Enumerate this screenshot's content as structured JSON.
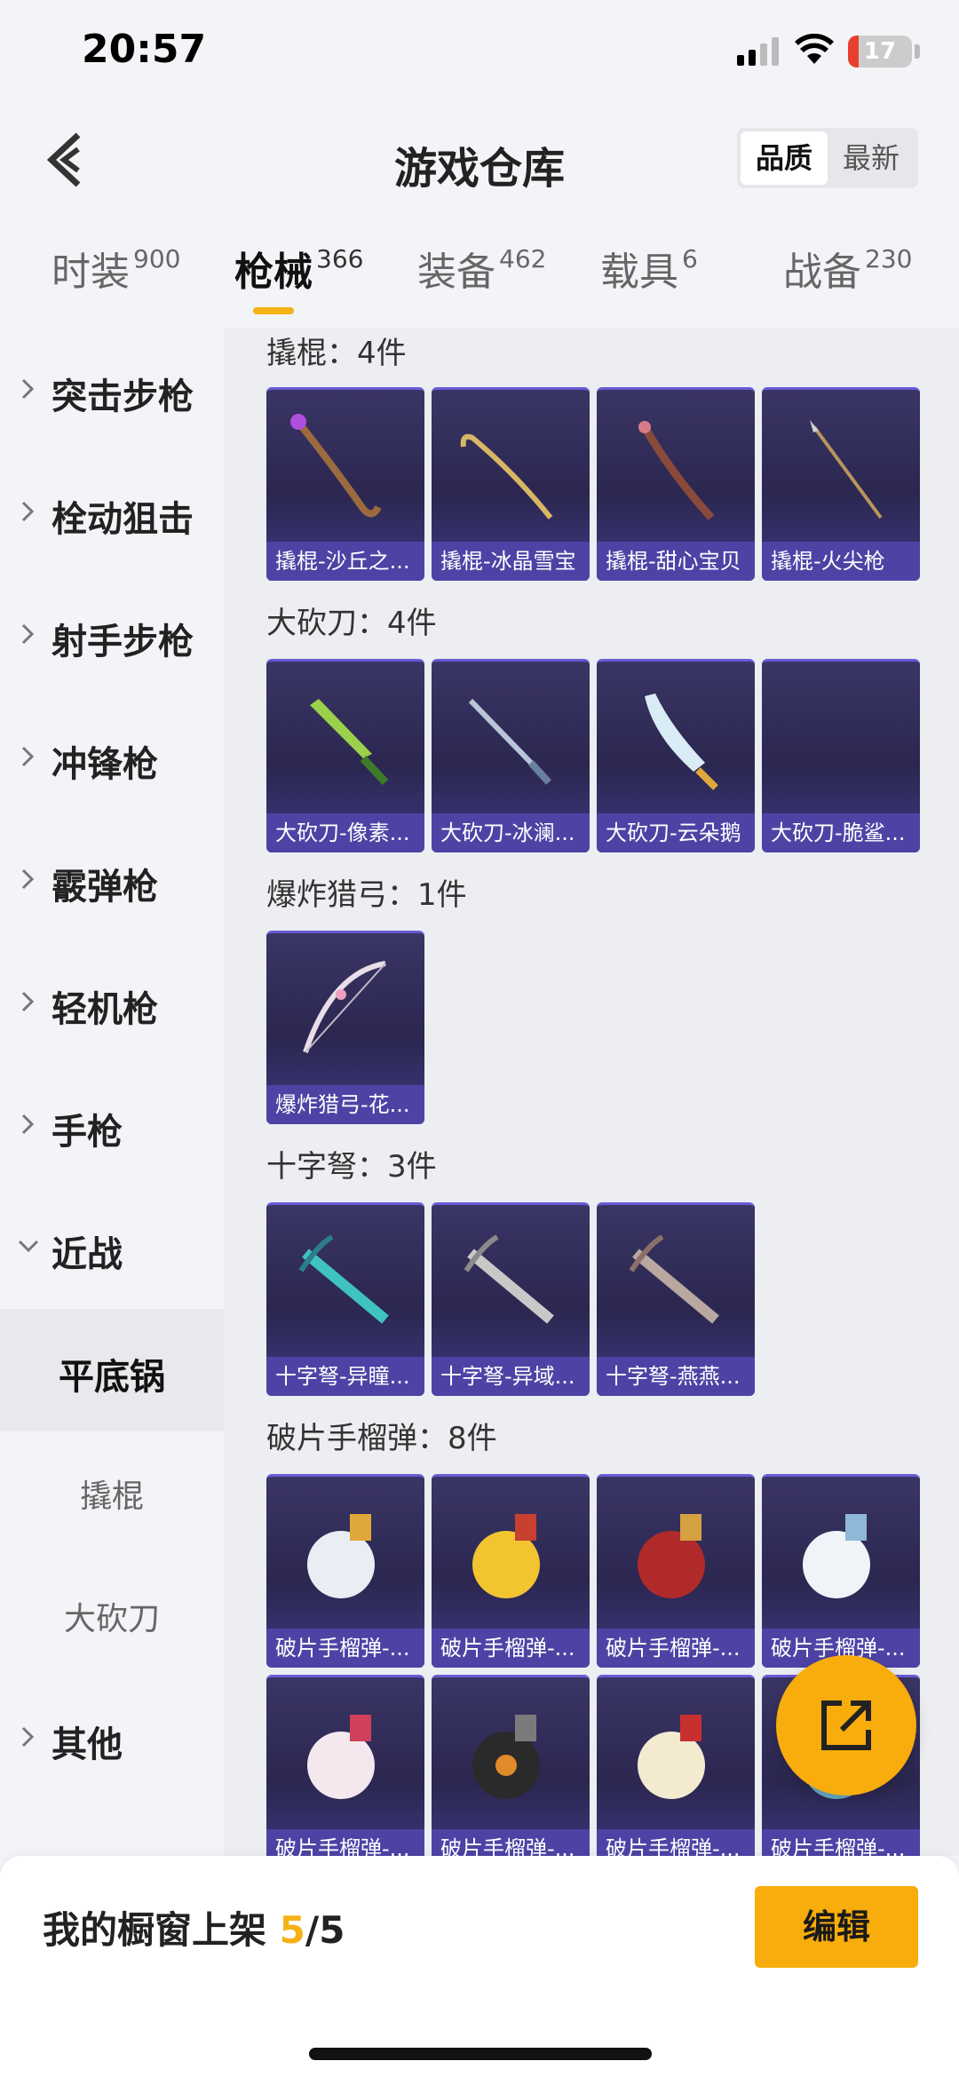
{
  "status": {
    "time": "20:57",
    "battery": "17",
    "battery_level": 0.17
  },
  "header": {
    "title": "游戏仓库",
    "sort": [
      "品质",
      "最新"
    ],
    "sort_active": "品质"
  },
  "tabs": [
    {
      "label": "时装",
      "count": "900"
    },
    {
      "label": "枪械",
      "count": "366",
      "active": true
    },
    {
      "label": "装备",
      "count": "462"
    },
    {
      "label": "载具",
      "count": "6"
    },
    {
      "label": "战备",
      "count": "230"
    }
  ],
  "sidebar": {
    "items": [
      "突击步枪",
      "栓动狙击",
      "射手步枪",
      "冲锋枪",
      "霰弹枪",
      "轻机枪",
      "手枪",
      "近战",
      "平底锅",
      "撬棍",
      "大砍刀",
      "其他"
    ]
  },
  "sections": [
    {
      "title": "撬棍：4件",
      "items": [
        "撬棍-沙丘之...",
        "撬棍-冰晶雪宝",
        "撬棍-甜心宝贝",
        "撬棍-火尖枪"
      ]
    },
    {
      "title": "大砍刀：4件",
      "items": [
        "大砍刀-像素...",
        "大砍刀-冰澜...",
        "大砍刀-云朵鹅",
        "大砍刀-脆鲨..."
      ]
    },
    {
      "title": "爆炸猎弓：1件",
      "items": [
        "爆炸猎弓-花..."
      ]
    },
    {
      "title": "十字弩：3件",
      "items": [
        "十字弩-异瞳...",
        "十字弩-异域...",
        "十字弩-燕燕..."
      ]
    },
    {
      "title": "破片手榴弹：8件",
      "items": [
        "破片手榴弹-...",
        "破片手榴弹-...",
        "破片手榴弹-...",
        "破片手榴弹-...",
        "破片手榴弹-...",
        "破片手榴弹-...",
        "破片手榴弹-...",
        "破片手榴弹-..."
      ]
    }
  ],
  "bottom": {
    "shelf_label": "我的橱窗上架 ",
    "shelf_current": "5",
    "shelf_total": "/5",
    "edit_label": "编辑"
  },
  "colors": {
    "accent": "#f8ad0c",
    "card_bg": "#2b2750",
    "card_caption": "#4e43a5"
  }
}
